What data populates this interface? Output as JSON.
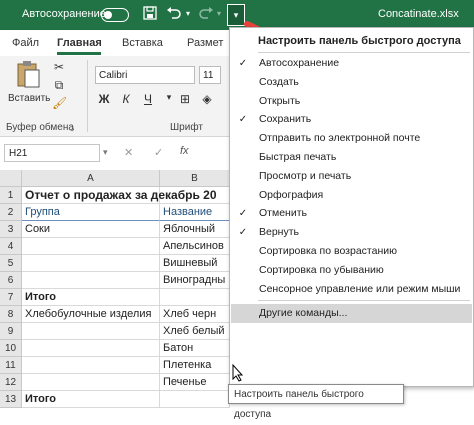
{
  "titlebar": {
    "autosave_label": "Автосохранение",
    "autosave_state": "off",
    "filename": "Concatinate.xlsx",
    "icons": [
      "save-icon",
      "undo-icon",
      "redo-icon",
      "customize-dropdown-icon"
    ],
    "bg_color": "#217346"
  },
  "ribbon_tabs": [
    "Файл",
    "Главная",
    "Вставка",
    "Размет"
  ],
  "ribbon": {
    "paste_label": "Вставить",
    "clipboard_label": "Буфер обмена",
    "font_label": "Шрифт",
    "font_name": "Calibri",
    "font_size": "11",
    "bold": "Ж",
    "italic": "К",
    "underline": "Ч"
  },
  "formula_bar": {
    "name_box": "H21"
  },
  "sheet": {
    "columns": [
      "A",
      "B"
    ],
    "rows": [
      "1",
      "2",
      "3",
      "4",
      "5",
      "6",
      "7",
      "8",
      "9",
      "10",
      "11",
      "12",
      "13"
    ],
    "cells": {
      "A1": "Отчет о продажах за декабрь 20",
      "A2": "Группа",
      "B2": "Название",
      "A3": "Соки",
      "B3": "Яблочный",
      "B4": "Апельсинов",
      "B5": "Вишневый",
      "B6": "Виноградны",
      "A7": "Итого",
      "A8": "Хлебобулочные изделия",
      "B8": "Хлеб черн",
      "B9": "Хлеб белый",
      "B10": "Батон",
      "B11": "Плетенка",
      "B12": "Печенье",
      "A13": "Итого"
    }
  },
  "qat_menu": {
    "title": "Настроить панель быстрого доступа",
    "items": [
      {
        "label": "Автосохранение",
        "checked": true
      },
      {
        "label": "Создать",
        "checked": false
      },
      {
        "label": "Открыть",
        "checked": false
      },
      {
        "label": "Сохранить",
        "checked": true
      },
      {
        "label": "Отправить по электронной почте",
        "checked": false
      },
      {
        "label": "Быстрая печать",
        "checked": false
      },
      {
        "label": "Просмотр и печать",
        "checked": false
      },
      {
        "label": "Орфография",
        "checked": false
      },
      {
        "label": "Отменить",
        "checked": true
      },
      {
        "label": "Вернуть",
        "checked": true
      },
      {
        "label": "Сортировка по возрастанию",
        "checked": false
      },
      {
        "label": "Сортировка по убыванию",
        "checked": false
      },
      {
        "label": "Сенсорное управление или режим мыши",
        "checked": false
      }
    ],
    "more_commands": "Другие команды...",
    "check_mark": "✓"
  },
  "tooltip": "Настроить панель быстрого доступа",
  "annotation_color": "#e8413a"
}
